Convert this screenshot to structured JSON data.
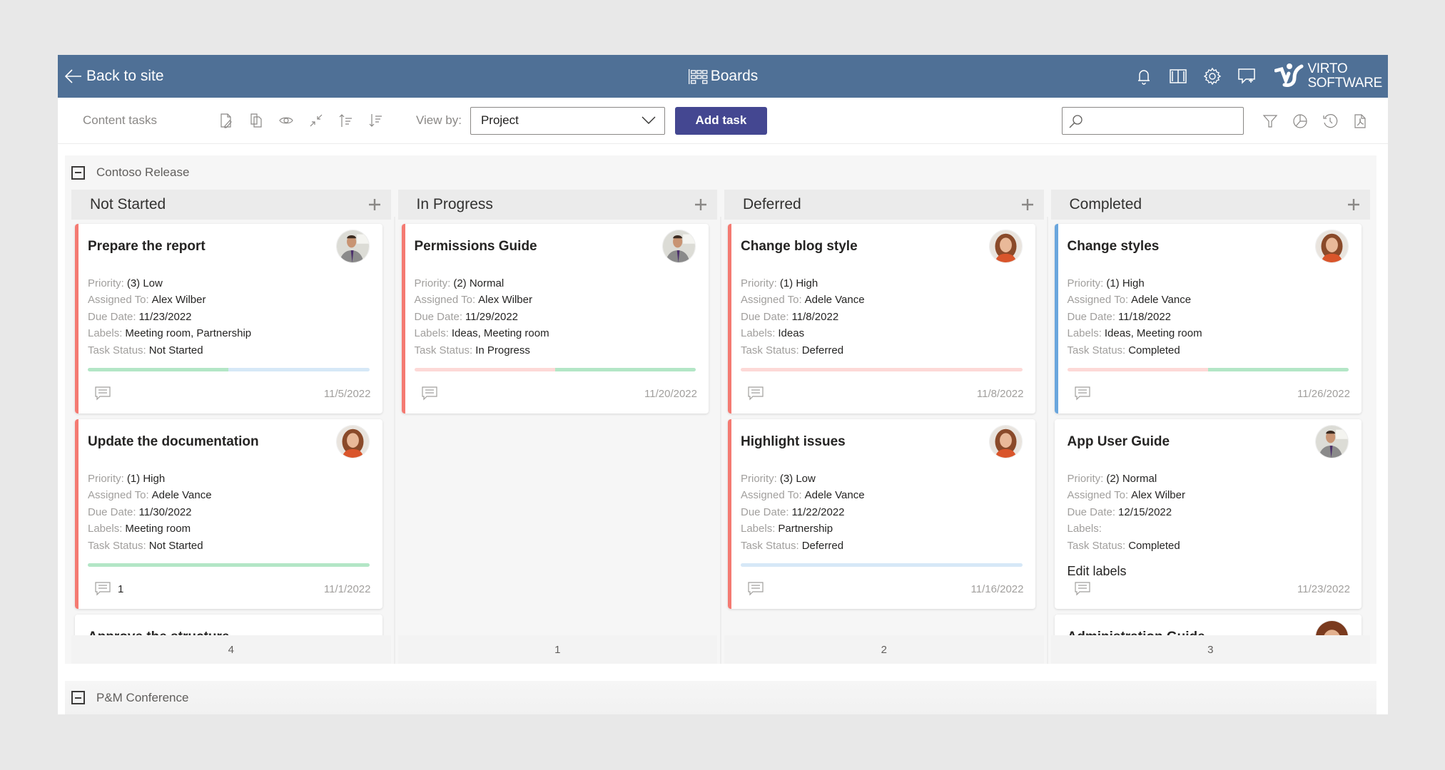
{
  "header": {
    "back_label": "Back to site",
    "title": "Boards",
    "icons": [
      "bell-icon",
      "book-icon",
      "gear-icon",
      "feedback-icon"
    ],
    "logo_line1": "VIRTO",
    "logo_line2": "SOFTWARE"
  },
  "toolbar": {
    "list_name": "Content tasks",
    "icons": [
      "edit-icon",
      "copy-icon",
      "view-icon",
      "collapse-icon",
      "sort-ascending-icon",
      "sort-descending-icon"
    ],
    "view_by_label": "View by:",
    "view_by_value": "Project",
    "add_task_label": "Add task",
    "search_placeholder": "",
    "right_icons": [
      "filter-icon",
      "chart-icon",
      "history-icon",
      "pdf-icon"
    ]
  },
  "colors": {
    "header_bg": "#4f7096",
    "primary_button": "#444791",
    "accent_red": "#f47a72",
    "accent_blue": "#6aa6dd",
    "progress_green": "#b3e6c6",
    "progress_blue": "#d6e8f7",
    "progress_pink": "#fdd9d7"
  },
  "groups": [
    {
      "name": "Contoso Release",
      "expanded": true,
      "columns": [
        {
          "title": "Not Started",
          "count": "4",
          "cards": [
            {
              "title": "Prepare the report",
              "avatar": "male",
              "accent": "#f47a72",
              "priority": "(3) Low",
              "assigned_to": "Alex Wilber",
              "due_date": "11/23/2022",
              "labels": "Meeting room, Partnership",
              "task_status": "Not Started",
              "progress": [
                [
                  "#b3e6c6",
                  50
                ],
                [
                  "#d6e8f7",
                  50
                ]
              ],
              "comments": "",
              "date": "11/5/2022"
            },
            {
              "title": "Update the documentation",
              "avatar": "female",
              "accent": "#f47a72",
              "priority": "(1) High",
              "assigned_to": "Adele Vance",
              "due_date": "11/30/2022",
              "labels": "Meeting room",
              "task_status": "Not Started",
              "progress": [
                [
                  "#b3e6c6",
                  100
                ]
              ],
              "comments": "1",
              "date": "11/1/2022"
            },
            {
              "title": "Approve the structure",
              "partial": true
            }
          ]
        },
        {
          "title": "In Progress",
          "count": "1",
          "cards": [
            {
              "title": "Permissions Guide",
              "avatar": "male",
              "accent": "#f47a72",
              "priority": "(2) Normal",
              "assigned_to": "Alex Wilber",
              "due_date": "11/29/2022",
              "labels": "Ideas, Meeting room",
              "task_status": "In Progress",
              "progress": [
                [
                  "#fdd9d7",
                  50
                ],
                [
                  "#b3e6c6",
                  50
                ]
              ],
              "comments": "",
              "date": "11/20/2022"
            }
          ]
        },
        {
          "title": "Deferred",
          "count": "2",
          "cards": [
            {
              "title": "Change blog style",
              "avatar": "female",
              "accent": "#f47a72",
              "priority": "(1) High",
              "assigned_to": "Adele Vance",
              "due_date": "11/8/2022",
              "labels": "Ideas",
              "task_status": "Deferred",
              "progress": [
                [
                  "#fdd9d7",
                  100
                ]
              ],
              "comments": "",
              "date": "11/8/2022"
            },
            {
              "title": "Highlight issues",
              "avatar": "female",
              "accent": "#f47a72",
              "priority": "(3) Low",
              "assigned_to": "Adele Vance",
              "due_date": "11/22/2022",
              "labels": "Partnership",
              "task_status": "Deferred",
              "progress": [
                [
                  "#d6e8f7",
                  100
                ]
              ],
              "comments": "",
              "date": "11/16/2022"
            }
          ]
        },
        {
          "title": "Completed",
          "count": "3",
          "cards": [
            {
              "title": "Change styles",
              "avatar": "female",
              "accent": "#6aa6dd",
              "priority": "(1) High",
              "assigned_to": "Adele Vance",
              "due_date": "11/18/2022",
              "labels": "Ideas, Meeting room",
              "task_status": "Completed",
              "progress": [
                [
                  "#fdd9d7",
                  50
                ],
                [
                  "#b3e6c6",
                  50
                ]
              ],
              "comments": "",
              "date": "11/26/2022"
            },
            {
              "title": "App User Guide",
              "avatar": "male",
              "accent": "",
              "priority": "(2) Normal",
              "assigned_to": "Alex Wilber",
              "due_date": "12/15/2022",
              "labels": "",
              "task_status": "Completed",
              "progress": [],
              "edit_labels": "Edit labels",
              "comments": "",
              "date": "11/23/2022"
            },
            {
              "title": "Administration Guide",
              "partial": true,
              "avatar": "glasses"
            }
          ]
        }
      ]
    },
    {
      "name": "P&M Conference",
      "expanded": false
    }
  ],
  "field_labels": {
    "priority": "Priority:",
    "assigned_to": "Assigned To:",
    "due_date": "Due Date:",
    "labels": "Labels:",
    "task_status": "Task Status:"
  }
}
